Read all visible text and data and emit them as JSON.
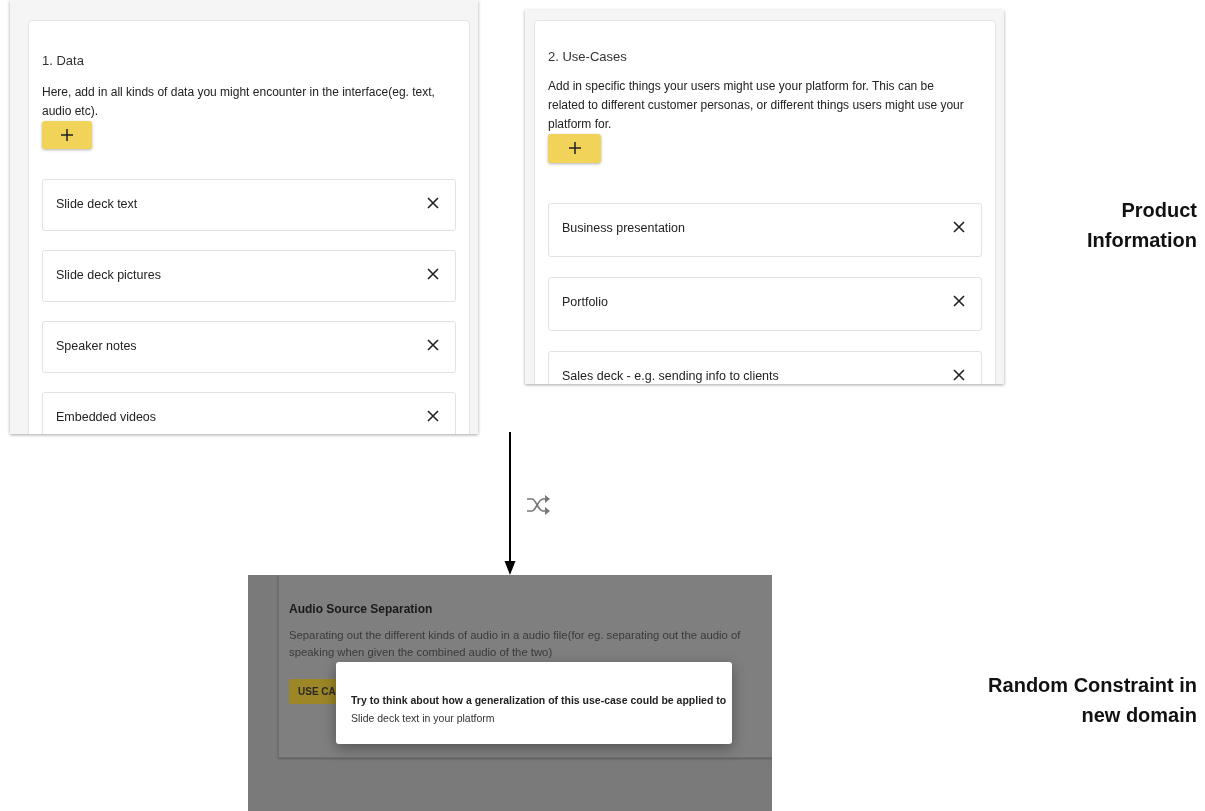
{
  "panels": [
    {
      "heading": "1. Data",
      "description": "Here, add in all kinds of data you might encounter in the interface(eg. text, audio etc).",
      "items": [
        {
          "label": "Slide deck text"
        },
        {
          "label": "Slide deck pictures"
        },
        {
          "label": "Speaker notes"
        },
        {
          "label": "Embedded videos"
        }
      ]
    },
    {
      "heading": "2. Use-Cases",
      "description": "Add in specific things your users might use your platform for. This can be related to different customer personas, or different things users might use your platform for.",
      "items": [
        {
          "label": "Business presentation"
        },
        {
          "label": "Portfolio"
        },
        {
          "label": "Sales deck - e.g. sending info to clients"
        }
      ]
    }
  ],
  "labels": [
    "Product Information",
    "Random Constraint in new domain"
  ],
  "constraint_screen": {
    "card_title": "Audio Source Separation",
    "card_description_lines": [
      "Separating out the different kinds of audio in a audio file(for eg. separating out the audio of",
      "speaking when given the combined audio of the two)"
    ],
    "card_button": "USE CA",
    "dialog": {
      "title": "Try to think about how a generalization of this use-case could be applied to",
      "text": "Slide deck text in your platform"
    }
  }
}
